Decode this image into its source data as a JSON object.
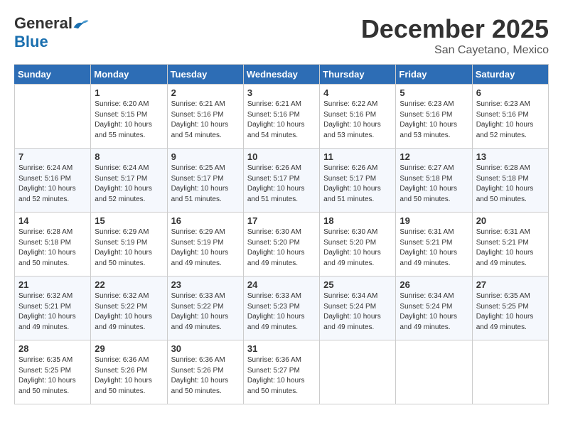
{
  "header": {
    "logo_general": "General",
    "logo_blue": "Blue",
    "month": "December 2025",
    "location": "San Cayetano, Mexico"
  },
  "weekdays": [
    "Sunday",
    "Monday",
    "Tuesday",
    "Wednesday",
    "Thursday",
    "Friday",
    "Saturday"
  ],
  "weeks": [
    [
      {
        "day": "",
        "detail": ""
      },
      {
        "day": "1",
        "detail": "Sunrise: 6:20 AM\nSunset: 5:15 PM\nDaylight: 10 hours\nand 55 minutes."
      },
      {
        "day": "2",
        "detail": "Sunrise: 6:21 AM\nSunset: 5:16 PM\nDaylight: 10 hours\nand 54 minutes."
      },
      {
        "day": "3",
        "detail": "Sunrise: 6:21 AM\nSunset: 5:16 PM\nDaylight: 10 hours\nand 54 minutes."
      },
      {
        "day": "4",
        "detail": "Sunrise: 6:22 AM\nSunset: 5:16 PM\nDaylight: 10 hours\nand 53 minutes."
      },
      {
        "day": "5",
        "detail": "Sunrise: 6:23 AM\nSunset: 5:16 PM\nDaylight: 10 hours\nand 53 minutes."
      },
      {
        "day": "6",
        "detail": "Sunrise: 6:23 AM\nSunset: 5:16 PM\nDaylight: 10 hours\nand 52 minutes."
      }
    ],
    [
      {
        "day": "7",
        "detail": "Sunrise: 6:24 AM\nSunset: 5:16 PM\nDaylight: 10 hours\nand 52 minutes."
      },
      {
        "day": "8",
        "detail": "Sunrise: 6:24 AM\nSunset: 5:17 PM\nDaylight: 10 hours\nand 52 minutes."
      },
      {
        "day": "9",
        "detail": "Sunrise: 6:25 AM\nSunset: 5:17 PM\nDaylight: 10 hours\nand 51 minutes."
      },
      {
        "day": "10",
        "detail": "Sunrise: 6:26 AM\nSunset: 5:17 PM\nDaylight: 10 hours\nand 51 minutes."
      },
      {
        "day": "11",
        "detail": "Sunrise: 6:26 AM\nSunset: 5:17 PM\nDaylight: 10 hours\nand 51 minutes."
      },
      {
        "day": "12",
        "detail": "Sunrise: 6:27 AM\nSunset: 5:18 PM\nDaylight: 10 hours\nand 50 minutes."
      },
      {
        "day": "13",
        "detail": "Sunrise: 6:28 AM\nSunset: 5:18 PM\nDaylight: 10 hours\nand 50 minutes."
      }
    ],
    [
      {
        "day": "14",
        "detail": "Sunrise: 6:28 AM\nSunset: 5:18 PM\nDaylight: 10 hours\nand 50 minutes."
      },
      {
        "day": "15",
        "detail": "Sunrise: 6:29 AM\nSunset: 5:19 PM\nDaylight: 10 hours\nand 50 minutes."
      },
      {
        "day": "16",
        "detail": "Sunrise: 6:29 AM\nSunset: 5:19 PM\nDaylight: 10 hours\nand 49 minutes."
      },
      {
        "day": "17",
        "detail": "Sunrise: 6:30 AM\nSunset: 5:20 PM\nDaylight: 10 hours\nand 49 minutes."
      },
      {
        "day": "18",
        "detail": "Sunrise: 6:30 AM\nSunset: 5:20 PM\nDaylight: 10 hours\nand 49 minutes."
      },
      {
        "day": "19",
        "detail": "Sunrise: 6:31 AM\nSunset: 5:21 PM\nDaylight: 10 hours\nand 49 minutes."
      },
      {
        "day": "20",
        "detail": "Sunrise: 6:31 AM\nSunset: 5:21 PM\nDaylight: 10 hours\nand 49 minutes."
      }
    ],
    [
      {
        "day": "21",
        "detail": "Sunrise: 6:32 AM\nSunset: 5:21 PM\nDaylight: 10 hours\nand 49 minutes."
      },
      {
        "day": "22",
        "detail": "Sunrise: 6:32 AM\nSunset: 5:22 PM\nDaylight: 10 hours\nand 49 minutes."
      },
      {
        "day": "23",
        "detail": "Sunrise: 6:33 AM\nSunset: 5:22 PM\nDaylight: 10 hours\nand 49 minutes."
      },
      {
        "day": "24",
        "detail": "Sunrise: 6:33 AM\nSunset: 5:23 PM\nDaylight: 10 hours\nand 49 minutes."
      },
      {
        "day": "25",
        "detail": "Sunrise: 6:34 AM\nSunset: 5:24 PM\nDaylight: 10 hours\nand 49 minutes."
      },
      {
        "day": "26",
        "detail": "Sunrise: 6:34 AM\nSunset: 5:24 PM\nDaylight: 10 hours\nand 49 minutes."
      },
      {
        "day": "27",
        "detail": "Sunrise: 6:35 AM\nSunset: 5:25 PM\nDaylight: 10 hours\nand 49 minutes."
      }
    ],
    [
      {
        "day": "28",
        "detail": "Sunrise: 6:35 AM\nSunset: 5:25 PM\nDaylight: 10 hours\nand 50 minutes."
      },
      {
        "day": "29",
        "detail": "Sunrise: 6:36 AM\nSunset: 5:26 PM\nDaylight: 10 hours\nand 50 minutes."
      },
      {
        "day": "30",
        "detail": "Sunrise: 6:36 AM\nSunset: 5:26 PM\nDaylight: 10 hours\nand 50 minutes."
      },
      {
        "day": "31",
        "detail": "Sunrise: 6:36 AM\nSunset: 5:27 PM\nDaylight: 10 hours\nand 50 minutes."
      },
      {
        "day": "",
        "detail": ""
      },
      {
        "day": "",
        "detail": ""
      },
      {
        "day": "",
        "detail": ""
      }
    ]
  ]
}
